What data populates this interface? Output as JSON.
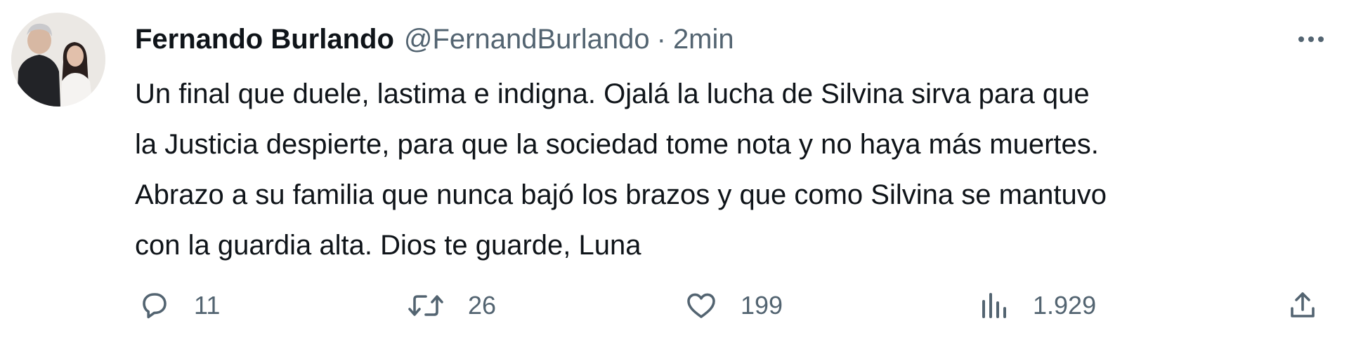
{
  "tweet": {
    "author_name": "Fernando Burlando",
    "handle": "@FernandBurlando",
    "separator": "·",
    "time": "2min",
    "text_lines": [
      "Un final que duele, lastima e indigna. Ojalá la lucha de Silvina sirva para que",
      "la Justicia despierte, para que la sociedad tome nota y no haya más muertes.",
      "Abrazo a su familia que nunca bajó los brazos y que como Silvina se mantuvo",
      "con la guardia alta. Dios te guarde, Luna"
    ]
  },
  "actions": {
    "replies": "11",
    "retweets": "26",
    "likes": "199",
    "views": "1.929"
  },
  "icons": {
    "reply": "speech-bubble-icon",
    "retweet": "retweet-arrows-icon",
    "like": "heart-icon",
    "views": "bar-chart-icon",
    "share": "share-upload-icon",
    "more": "more-dots-icon"
  },
  "colors": {
    "text": "#0f1419",
    "secondary": "#536471",
    "background": "#ffffff"
  }
}
